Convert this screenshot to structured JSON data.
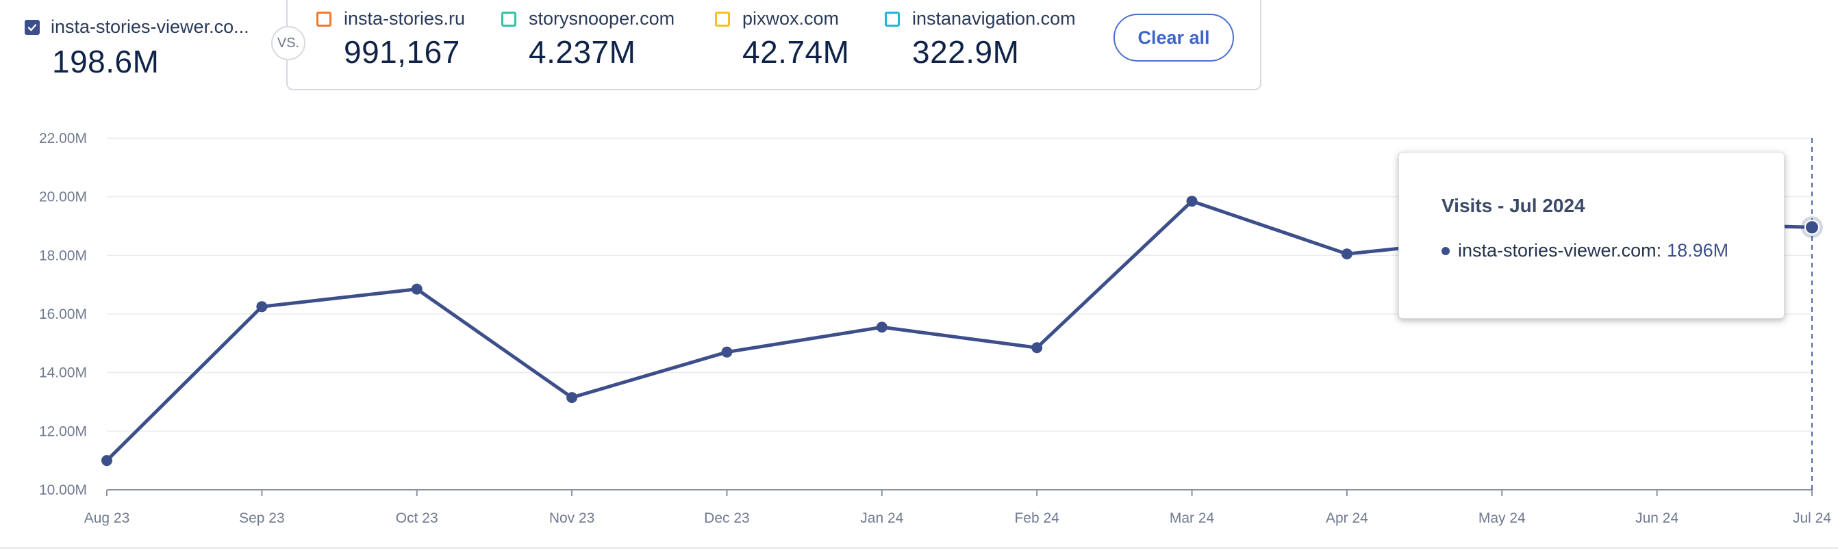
{
  "primary": {
    "name": "insta-stories-viewer.co...",
    "value": "198.6M",
    "checked": true
  },
  "vs_label": "VS.",
  "competitors": [
    {
      "name": "insta-stories.ru",
      "value": "991,167",
      "color": "#f07a2e"
    },
    {
      "name": "storysnooper.com",
      "value": "4.237M",
      "color": "#2ec4a0"
    },
    {
      "name": "pixwox.com",
      "value": "42.74M",
      "color": "#f2c023"
    },
    {
      "name": "instanavigation.com",
      "value": "322.9M",
      "color": "#22b5d6"
    }
  ],
  "clear_all_label": "Clear all",
  "tooltip": {
    "title": "Visits - Jul 2024",
    "series_label": "insta-stories-viewer.com:",
    "value": "18.96M"
  },
  "chart_data": {
    "type": "line",
    "x": [
      "Aug 23",
      "Sep 23",
      "Oct 23",
      "Nov 23",
      "Dec 23",
      "Jan 24",
      "Feb 24",
      "Mar 24",
      "Apr 24",
      "May 24",
      "Jun 24",
      "Jul 24"
    ],
    "series": [
      {
        "name": "insta-stories-viewer.com",
        "color": "#3d4f8a",
        "values": [
          11.0,
          16.25,
          16.85,
          13.15,
          14.7,
          15.55,
          14.85,
          19.85,
          18.05,
          18.6,
          19.1,
          18.96
        ]
      }
    ],
    "y_ticks": [
      "10.00M",
      "12.00M",
      "14.00M",
      "16.00M",
      "18.00M",
      "20.00M",
      "22.00M"
    ],
    "ylim": [
      10,
      22
    ],
    "grid": true,
    "highlight_index": 11
  }
}
